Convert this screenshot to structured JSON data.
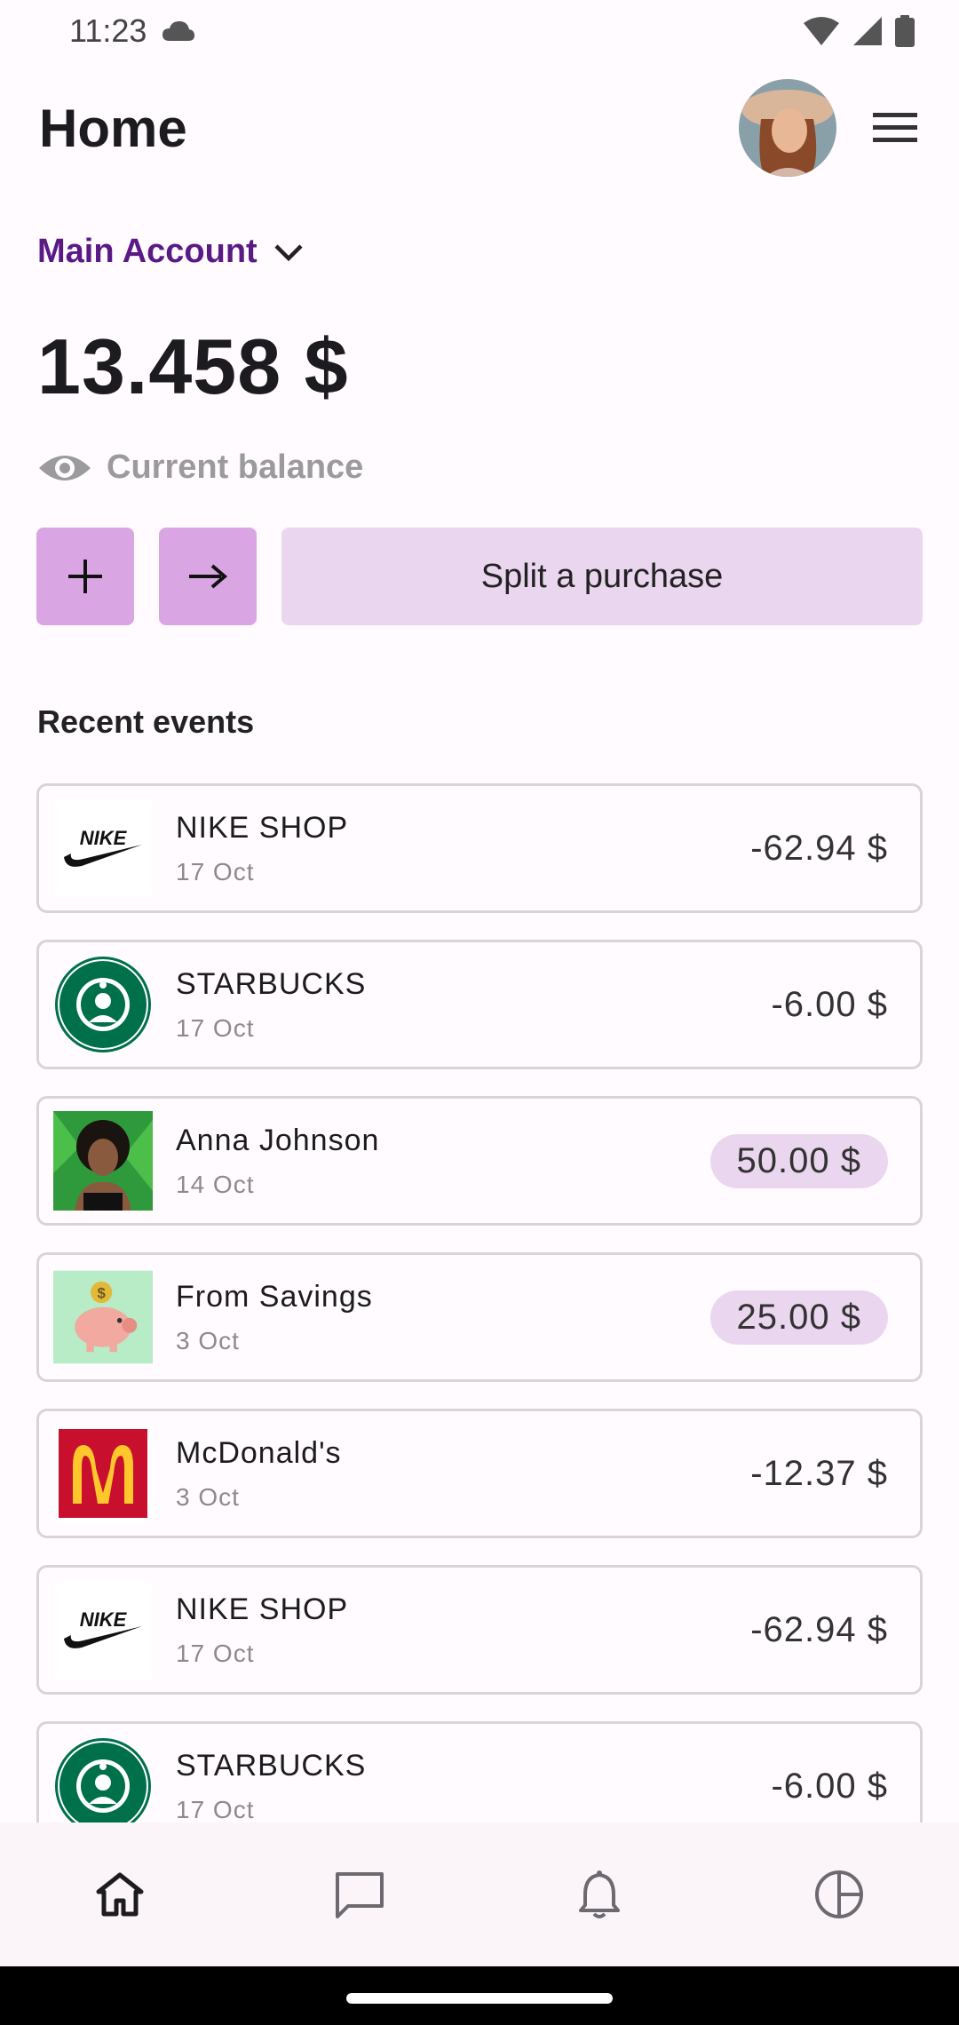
{
  "status_bar": {
    "time": "11:23"
  },
  "header": {
    "title": "Home"
  },
  "account": {
    "name": "Main Account"
  },
  "balance": {
    "amount": "13.458 $",
    "label": "Current balance"
  },
  "actions": {
    "split_label": "Split a purchase"
  },
  "recent": {
    "title": "Recent events",
    "events": [
      {
        "name": "NIKE SHOP",
        "date": "17 Oct",
        "amount": "-62.94 $"
      },
      {
        "name": "STARBUCKS",
        "date": "17 Oct",
        "amount": "-6.00 $"
      },
      {
        "name": "Anna Johnson",
        "date": "14 Oct",
        "amount": "50.00 $"
      },
      {
        "name": "From Savings",
        "date": "3 Oct",
        "amount": "25.00 $"
      },
      {
        "name": "McDonald's",
        "date": "3 Oct",
        "amount": "-12.37 $"
      },
      {
        "name": "NIKE SHOP",
        "date": "17 Oct",
        "amount": "-62.94 $"
      },
      {
        "name": "STARBUCKS",
        "date": "17 Oct",
        "amount": "-6.00 $"
      }
    ]
  },
  "colors": {
    "accent": "#5a1a86",
    "button": "#d9a6e3",
    "button_light": "#ebd6ef",
    "background": "#fffbff"
  },
  "nav": {
    "items": [
      {
        "icon": "home-icon",
        "selected": true
      },
      {
        "icon": "chat-icon",
        "selected": false
      },
      {
        "icon": "bell-icon",
        "selected": false
      },
      {
        "icon": "pie-chart-icon",
        "selected": false
      }
    ]
  }
}
